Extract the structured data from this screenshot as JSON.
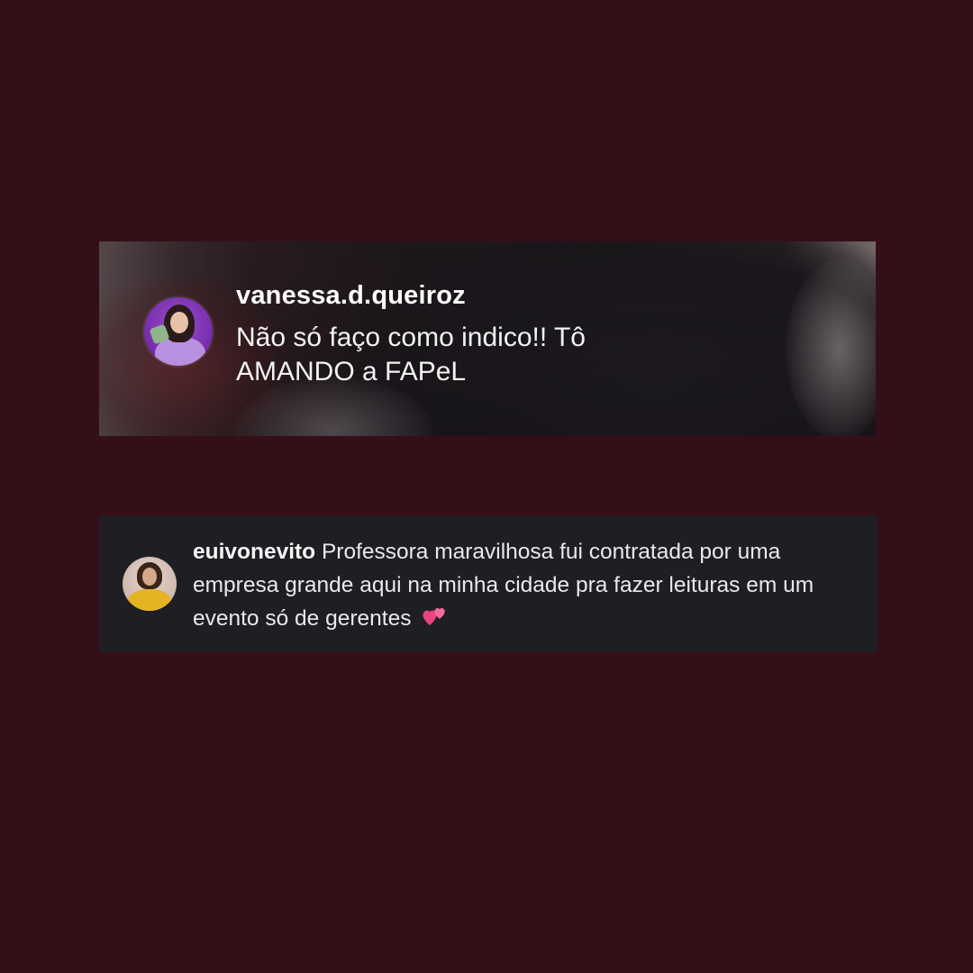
{
  "live_comment": {
    "username": "vanessa.d.queiroz",
    "text": "Não só faço como indico!! Tô AMANDO a FAPeL",
    "avatar_icon": "profile-photo-icon"
  },
  "feed_comment": {
    "username": "euivonevito",
    "text": "Professora maravilhosa fui contratada por uma empresa grande aqui na minha cidade pra fazer leituras em um evento só de gerentes",
    "emoji_icon": "two-hearts-icon",
    "avatar_icon": "profile-photo-icon"
  },
  "colors": {
    "page_background": "#350f18",
    "comment_card_background": "#1f1f23",
    "heart_pink": "#e8447e"
  }
}
